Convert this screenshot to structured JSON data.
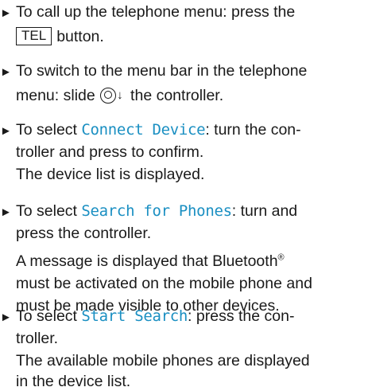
{
  "steps": [
    {
      "lines": [
        {
          "parts": [
            "To call up the telephone menu: press the"
          ]
        },
        {
          "key": "TEL",
          "after": "button."
        }
      ]
    },
    {
      "lines": [
        {
          "parts": [
            "To switch to the menu bar in the telephone"
          ]
        },
        {
          "before": "menu: slide ",
          "after": " the controller."
        }
      ]
    },
    {
      "lines": [
        {
          "before": "To select ",
          "term": "Connect Device",
          "after": ": turn the con-"
        },
        {
          "parts": [
            "troller and press to confirm."
          ]
        },
        {
          "parts": [
            "The device list is displayed."
          ]
        }
      ]
    },
    {
      "lines": [
        {
          "before": "To select ",
          "term": "Search for Phones",
          "after": ": turn and"
        },
        {
          "parts": [
            "press the controller."
          ]
        },
        {
          "before": "A message is displayed that Bluetooth",
          "sup": "®"
        },
        {
          "parts": [
            "must be activated on the mobile phone and"
          ]
        },
        {
          "parts": [
            "must be made visible to other devices."
          ]
        }
      ]
    },
    {
      "lines": [
        {
          "before": "To select ",
          "term": "Start Search",
          "after": ": press the con-"
        },
        {
          "parts": [
            "troller."
          ]
        },
        {
          "parts": [
            "The available mobile phones are displayed"
          ]
        },
        {
          "parts": [
            "in the device list."
          ]
        }
      ]
    }
  ],
  "bullet_glyph": "►",
  "colors": {
    "menu_term": "#1a8fc2",
    "text": "#1a1a1a"
  },
  "icons": {
    "controller": "controller-icon",
    "slide_down": "arrow-down-icon"
  }
}
